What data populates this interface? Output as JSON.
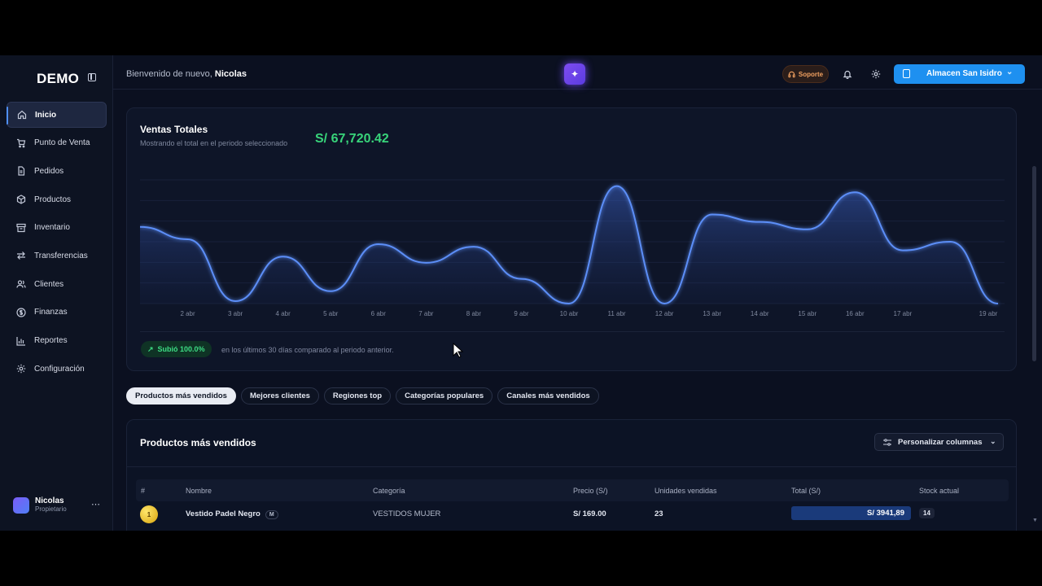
{
  "sidebar": {
    "logo": "DEMO",
    "items": [
      {
        "label": "Inicio",
        "icon": "home-icon"
      },
      {
        "label": "Punto de Venta",
        "icon": "cart-icon"
      },
      {
        "label": "Pedidos",
        "icon": "document-icon"
      },
      {
        "label": "Productos",
        "icon": "box-icon"
      },
      {
        "label": "Inventario",
        "icon": "archive-icon"
      },
      {
        "label": "Transferencias",
        "icon": "arrows-icon"
      },
      {
        "label": "Clientes",
        "icon": "users-icon"
      },
      {
        "label": "Finanzas",
        "icon": "dollar-icon"
      },
      {
        "label": "Reportes",
        "icon": "bar-chart-icon"
      },
      {
        "label": "Configuración",
        "icon": "gear-icon"
      }
    ],
    "user": {
      "name": "Nicolas",
      "role": "Propietario"
    }
  },
  "topbar": {
    "welcome_prefix": "Bienvenido de nuevo,",
    "welcome_name": "Nicolas",
    "support_label": "Soporte",
    "store_label": "Almacen San Isidro"
  },
  "sales": {
    "title": "Ventas Totales",
    "subtitle": "Mostrando el total en el periodo seleccionado",
    "total": "S/ 67,720.42",
    "trend_label": "Subió 100.0%",
    "trend_note": "en los últimos 30 días comparado al periodo anterior."
  },
  "chart_data": {
    "type": "area",
    "title": "Ventas Totales",
    "x": [
      "2 abr",
      "3 abr",
      "4 abr",
      "5 abr",
      "6 abr",
      "7 abr",
      "8 abr",
      "9 abr",
      "10 abr",
      "11 abr",
      "12 abr",
      "13 abr",
      "14 abr",
      "15 abr",
      "16 abr",
      "17 abr",
      "19 abr"
    ],
    "points": [
      {
        "x": "1 abr",
        "y": 0.62
      },
      {
        "x": "2 abr",
        "y": 0.52
      },
      {
        "x": "3 abr",
        "y": 0.02
      },
      {
        "x": "4 abr",
        "y": 0.38
      },
      {
        "x": "5 abr",
        "y": 0.1
      },
      {
        "x": "6 abr",
        "y": 0.48
      },
      {
        "x": "7 abr",
        "y": 0.33
      },
      {
        "x": "8 abr",
        "y": 0.46
      },
      {
        "x": "9 abr",
        "y": 0.2
      },
      {
        "x": "10 abr",
        "y": 0.0
      },
      {
        "x": "11 abr",
        "y": 0.95
      },
      {
        "x": "12 abr",
        "y": 0.0
      },
      {
        "x": "13 abr",
        "y": 0.72
      },
      {
        "x": "14 abr",
        "y": 0.66
      },
      {
        "x": "15 abr",
        "y": 0.6
      },
      {
        "x": "16 abr",
        "y": 0.9
      },
      {
        "x": "17 abr",
        "y": 0.43
      },
      {
        "x": "18 abr",
        "y": 0.5
      },
      {
        "x": "19 abr",
        "y": 0.0
      }
    ],
    "ylim": [
      0,
      1
    ],
    "xlabel": "",
    "ylabel": "",
    "grid": true,
    "line_color": "#5b8ef7"
  },
  "tabs": [
    "Productos más vendidos",
    "Mejores clientes",
    "Regiones top",
    "Categorías populares",
    "Canales más vendidos"
  ],
  "products": {
    "title": "Productos más vendidos",
    "customize_label": "Personalizar columnas",
    "columns": [
      "#",
      "Nombre",
      "Categoría",
      "Precio (S/)",
      "Unidades vendidas",
      "Total (S/)",
      "Stock actual"
    ],
    "rows": [
      {
        "rank": "1",
        "name": "Vestido Padel Negro",
        "size": "M",
        "category": "VESTIDOS MUJER",
        "price": "S/ 169.00",
        "units": "23",
        "total": "S/ 3941,89",
        "stock": "14"
      }
    ]
  },
  "colors": {
    "accent": "#1e90f0",
    "success": "#38d47a",
    "gold": "#f5c518"
  }
}
